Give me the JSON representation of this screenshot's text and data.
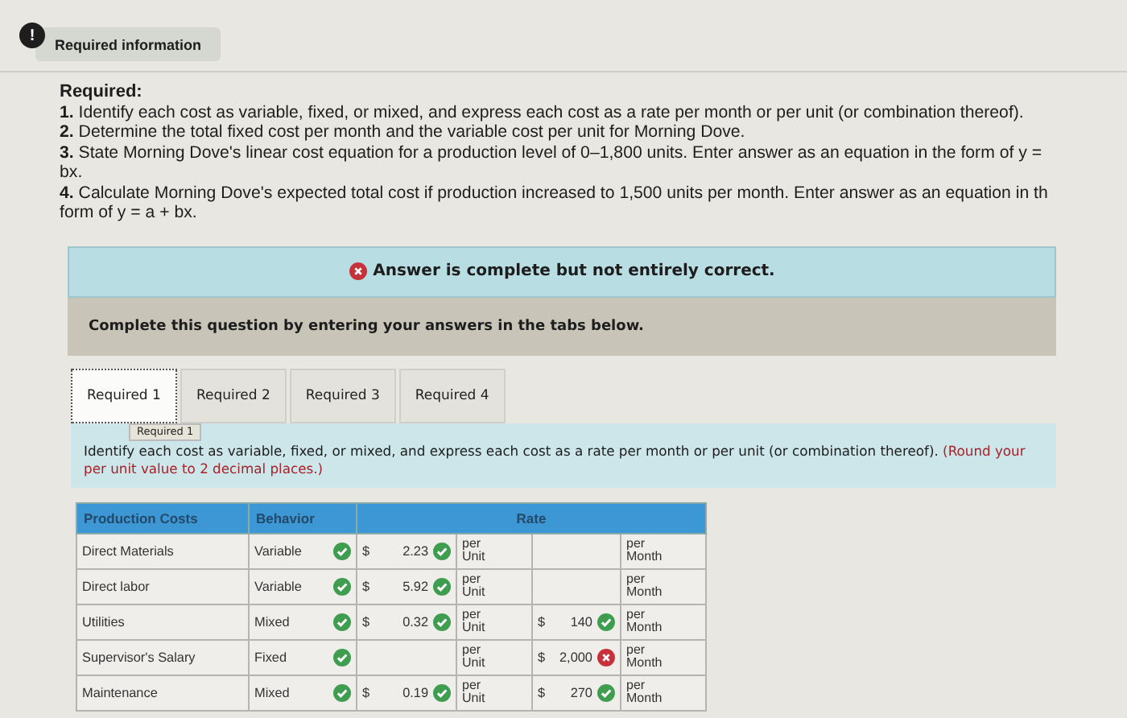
{
  "header": {
    "badge": "!",
    "tab": "Required information"
  },
  "required": {
    "heading": "Required:",
    "items": [
      "**1.** Identify each cost as variable, fixed, or mixed, and express each cost as a rate per month or per unit (or combination thereof).",
      "**2.** Determine the total fixed cost per month and the variable cost per unit for Morning Dove.",
      "**3.** State Morning Dove's linear cost equation for a production level of 0–1,800 units. Enter answer as an equation in the form of y =\nbx.",
      "**4.** Calculate Morning Dove's expected total cost if production increased to 1,500 units per month. Enter answer as an equation in th\nform of y = a + bx."
    ]
  },
  "result_banner": {
    "correct": false,
    "text": "Answer is complete but not entirely correct."
  },
  "instruction_band": "Complete this question by entering your answers in the tabs below.",
  "tabs": [
    {
      "label": "Required 1",
      "selected": true
    },
    {
      "label": "Required 2",
      "selected": false
    },
    {
      "label": "Required 3",
      "selected": false
    },
    {
      "label": "Required 4",
      "selected": false
    }
  ],
  "tooltip": "Required 1",
  "task": {
    "text": "Identify each cost as variable, fixed, or mixed, and express each cost as a rate per month or per unit (or combination thereof).",
    "note": "(Round your per unit value to 2 decimal places.)"
  },
  "table": {
    "columns": [
      "Production Costs",
      "Behavior",
      "Rate"
    ],
    "rows": [
      {
        "name": "Direct Materials",
        "behavior": "Variable",
        "behavior_correct": true,
        "unit_currency": "$",
        "unit_value": "2.23",
        "unit_correct": true,
        "unit_label": "per\nUnit",
        "month_label": "per\nMonth"
      },
      {
        "name": "Direct labor",
        "behavior": "Variable",
        "behavior_correct": true,
        "unit_currency": "$",
        "unit_value": "5.92",
        "unit_correct": true,
        "unit_label": "per\nUnit",
        "month_label": "per\nMonth"
      },
      {
        "name": "Utilities",
        "behavior": "Mixed",
        "behavior_correct": true,
        "unit_currency": "$",
        "unit_value": "0.32",
        "unit_correct": true,
        "unit_label": "per\nUnit",
        "month_currency": "$",
        "month_value": "140",
        "month_correct": true,
        "month_label": "per\nMonth"
      },
      {
        "name": "Supervisor's Salary",
        "behavior": "Fixed",
        "behavior_correct": true,
        "unit_label": "per\nUnit",
        "month_currency": "$",
        "month_value": "2,000",
        "month_correct": false,
        "month_label": "per\nMonth"
      },
      {
        "name": "Maintenance",
        "behavior": "Mixed",
        "behavior_correct": true,
        "unit_currency": "$",
        "unit_value": "0.19",
        "unit_correct": true,
        "unit_label": "per\nUnit",
        "month_currency": "$",
        "month_value": "270",
        "month_correct": true,
        "month_label": "per\nMonth"
      }
    ]
  }
}
